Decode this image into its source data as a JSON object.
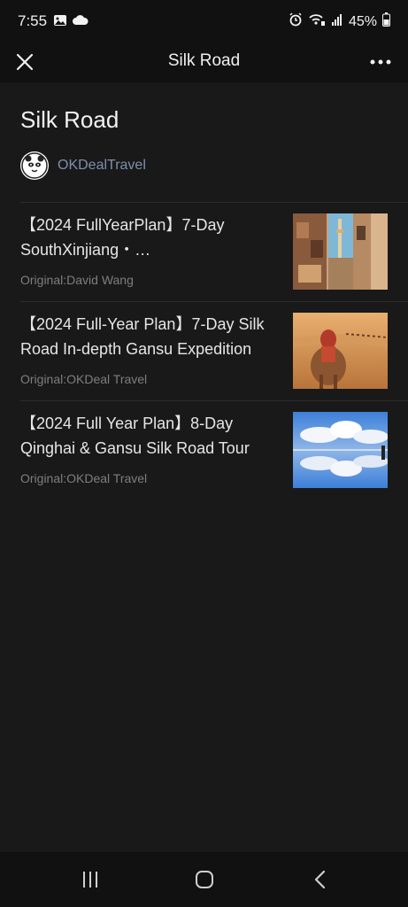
{
  "status": {
    "time": "7:55",
    "battery": "45%",
    "icons": [
      "image-icon",
      "cloud-icon",
      "alarm-icon",
      "wifi-calling-icon",
      "signal-icon",
      "battery-icon"
    ]
  },
  "nav": {
    "title": "Silk Road",
    "close_icon": "close-icon",
    "more_icon": "more-dots-icon"
  },
  "header": {
    "title": "Silk Road",
    "author": "OKDealTravel"
  },
  "articles": [
    {
      "title": "【2024 FullYearPlan】7-Day SouthXinjiang・…",
      "meta": "Original:David Wang",
      "thumb": "xinjiang-street-image"
    },
    {
      "title": "【2024 Full-Year Plan】7-Day Silk Road In-depth Gansu Expedition",
      "meta": "Original:OKDeal Travel",
      "thumb": "camel-desert-image"
    },
    {
      "title": "【2024 Full Year Plan】8-Day Qinghai & Gansu Silk Road Tour",
      "meta": "Original:OKDeal Travel",
      "thumb": "salt-lake-sky-image"
    }
  ],
  "colors": {
    "background": "#191919",
    "bars": "#111111",
    "author_link": "#7d90ad",
    "meta_text": "#7e7e7e"
  }
}
